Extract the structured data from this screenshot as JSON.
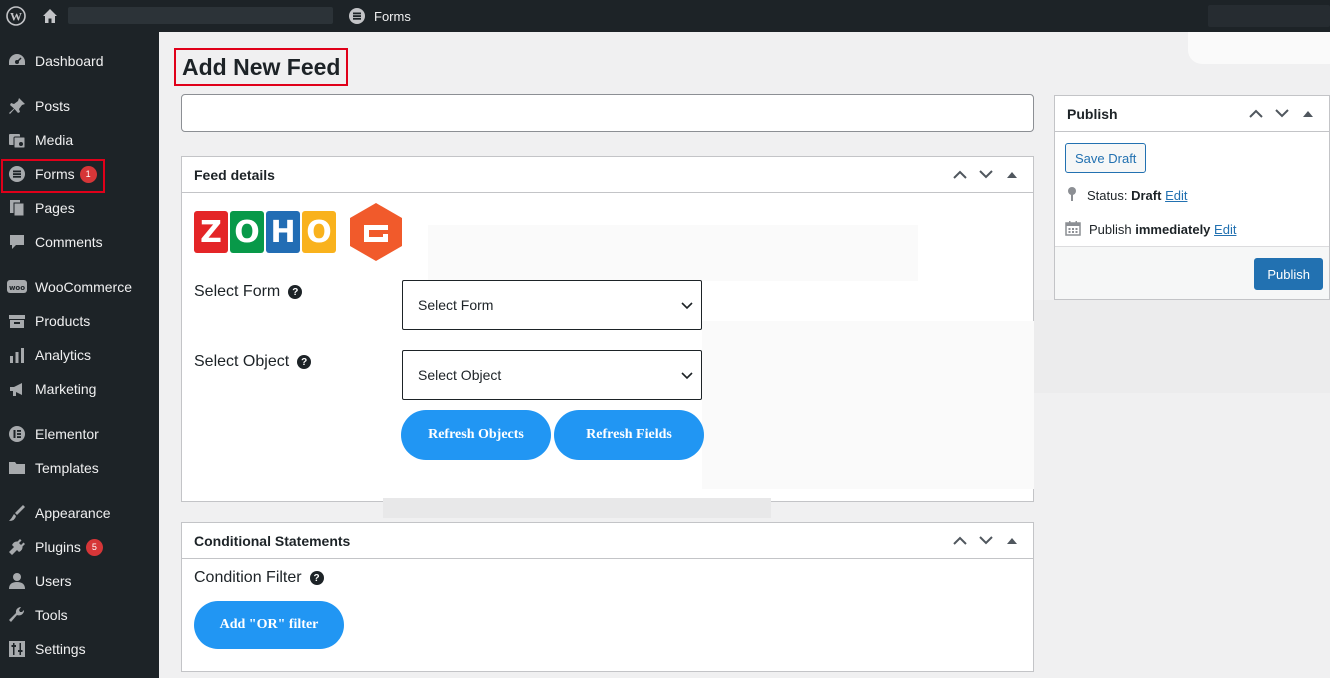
{
  "adminbar": {
    "forms_label": "Forms"
  },
  "sidebar": {
    "items": [
      {
        "label": "Dashboard",
        "icon": "dashboard-icon"
      },
      {
        "label": "Posts",
        "icon": "pin-icon"
      },
      {
        "label": "Media",
        "icon": "media-icon"
      },
      {
        "label": "Forms",
        "icon": "forms-icon",
        "badge": "1"
      },
      {
        "label": "Pages",
        "icon": "pages-icon"
      },
      {
        "label": "Comments",
        "icon": "comments-icon"
      },
      {
        "label": "WooCommerce",
        "icon": "woo-icon"
      },
      {
        "label": "Products",
        "icon": "products-icon"
      },
      {
        "label": "Analytics",
        "icon": "analytics-icon"
      },
      {
        "label": "Marketing",
        "icon": "megaphone-icon"
      },
      {
        "label": "Elementor",
        "icon": "elementor-icon"
      },
      {
        "label": "Templates",
        "icon": "folder-icon"
      },
      {
        "label": "Appearance",
        "icon": "brush-icon"
      },
      {
        "label": "Plugins",
        "icon": "plug-icon",
        "badge": "5"
      },
      {
        "label": "Users",
        "icon": "user-icon"
      },
      {
        "label": "Tools",
        "icon": "wrench-icon"
      },
      {
        "label": "Settings",
        "icon": "sliders-icon"
      }
    ]
  },
  "page": {
    "title": "Add New Feed",
    "title_input_value": ""
  },
  "feed_details": {
    "heading": "Feed details",
    "logo_letters": [
      "Z",
      "O",
      "H",
      "O"
    ],
    "select_form_label": "Select Form",
    "select_form_value": "Select Form",
    "select_object_label": "Select Object",
    "select_object_value": "Select Object",
    "refresh_objects": "Refresh Objects",
    "refresh_fields": "Refresh Fields"
  },
  "conditional": {
    "heading": "Conditional Statements",
    "condition_filter_label": "Condition Filter",
    "add_or_filter": "Add \"OR\" filter"
  },
  "publish": {
    "heading": "Publish",
    "save_draft": "Save Draft",
    "status_label": "Status:",
    "status_value": "Draft",
    "edit_status": "Edit",
    "publish_label": "Publish",
    "publish_when": "immediately",
    "edit_publish": "Edit",
    "publish_button": "Publish"
  },
  "colors": {
    "admin_dark": "#1d2327",
    "accent_blue": "#2271b1",
    "pill_blue": "#2196f3",
    "highlight_red": "#e0001a",
    "badge_red": "#d63638"
  }
}
